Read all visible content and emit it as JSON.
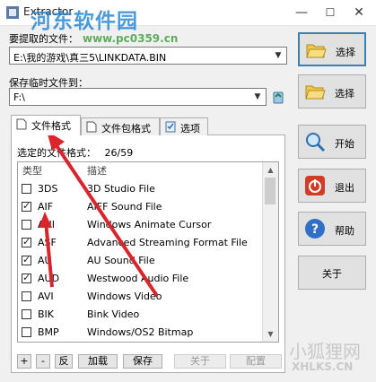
{
  "window": {
    "title": "Extractor",
    "controls": {
      "minimize": "—",
      "maximize": "☐",
      "close": "✕"
    }
  },
  "source": {
    "label": "要提取的文件：",
    "value": "E:\\我的游戏\\真三5\\LINKDATA.BIN"
  },
  "temp": {
    "label": "保存临时文件到：",
    "value": "F:\\"
  },
  "tabs": [
    "文件格式",
    "文件包格式",
    "选项"
  ],
  "selected_formats": {
    "label": "选定的文件格式：",
    "value": "26/59"
  },
  "list": {
    "columns": [
      "类型",
      "描述"
    ],
    "rows": [
      {
        "checked": false,
        "type": "3DS",
        "desc": "3D Studio File"
      },
      {
        "checked": true,
        "type": "AIF",
        "desc": "AIFF Sound File"
      },
      {
        "checked": false,
        "type": "ANI",
        "desc": "Windows Animate Cursor"
      },
      {
        "checked": true,
        "type": "ASF",
        "desc": "Advanced Streaming Format File"
      },
      {
        "checked": true,
        "type": "AU",
        "desc": "AU Sound File"
      },
      {
        "checked": true,
        "type": "AUD",
        "desc": "Westwood Audio File"
      },
      {
        "checked": false,
        "type": "AVI",
        "desc": "Windows Video"
      },
      {
        "checked": false,
        "type": "BIK",
        "desc": "Bink Video"
      },
      {
        "checked": false,
        "type": "BMP",
        "desc": "Windows/OS2 Bitmap"
      }
    ]
  },
  "bottom_buttons": {
    "plus": "+",
    "minus": "-",
    "invert": "反",
    "load": "加载",
    "save": "保存",
    "about": "关于",
    "config": "配置"
  },
  "right_buttons": {
    "browse_source": "选择",
    "browse_temp": "选择",
    "start": "开始",
    "exit": "退出",
    "help": "帮助",
    "about": "关于"
  },
  "watermarks": {
    "site_cn": "河东软件园",
    "site_url": "www.pc0359.cn",
    "brand_cn": "小狐狸网",
    "brand_url": "XHLKS.CN"
  },
  "colors": {
    "arrow_red": "#d9252b",
    "accent_blue": "#3c7fb1"
  }
}
